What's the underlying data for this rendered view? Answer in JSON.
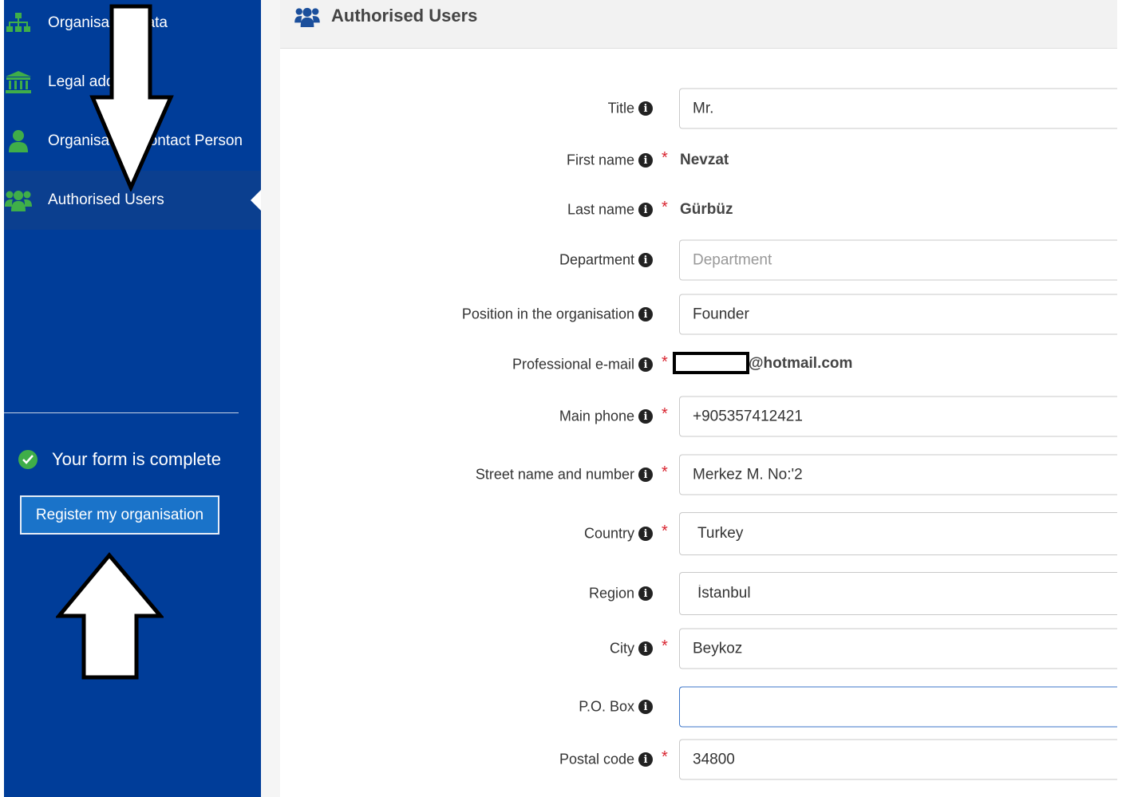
{
  "sidebar": {
    "items": [
      {
        "label": "Organisation data",
        "icon": "sitemap-icon"
      },
      {
        "label": "Legal address",
        "icon": "bank-icon"
      },
      {
        "label": "Organisation Contact Person",
        "icon": "user-icon"
      },
      {
        "label": "Authorised Users",
        "icon": "users-icon",
        "active": true
      }
    ],
    "status_text": "Your form is complete",
    "register_button": "Register my organisation"
  },
  "panel": {
    "title": "Authorised Users",
    "icon": "users-icon"
  },
  "form": {
    "title": {
      "label": "Title",
      "value": "Mr."
    },
    "first_name": {
      "label": "First name",
      "value": "Nevzat"
    },
    "last_name": {
      "label": "Last name",
      "value": "Gürbüz"
    },
    "department": {
      "label": "Department",
      "value": "",
      "placeholder": "Department"
    },
    "position": {
      "label": "Position in the organisation",
      "value": "Founder"
    },
    "email": {
      "label": "Professional e-mail",
      "value_visible": "@hotmail.com"
    },
    "phone": {
      "label": "Main phone",
      "value": "+905357412421"
    },
    "street": {
      "label": "Street name and number",
      "value": "Merkez M. No:'2"
    },
    "country": {
      "label": "Country",
      "value": "Turkey"
    },
    "region": {
      "label": "Region",
      "value": "İstanbul"
    },
    "city": {
      "label": "City",
      "value": "Beykoz"
    },
    "po_box": {
      "label": "P.O. Box",
      "value": ""
    },
    "postal_code": {
      "label": "Postal code",
      "value": "34800"
    }
  },
  "colors": {
    "sidebar_bg": "#003d99",
    "button_bg": "#1a73c9",
    "check_green": "#3fae49",
    "nav_icon_green": "#3fae49",
    "required_red": "#d9232f"
  }
}
